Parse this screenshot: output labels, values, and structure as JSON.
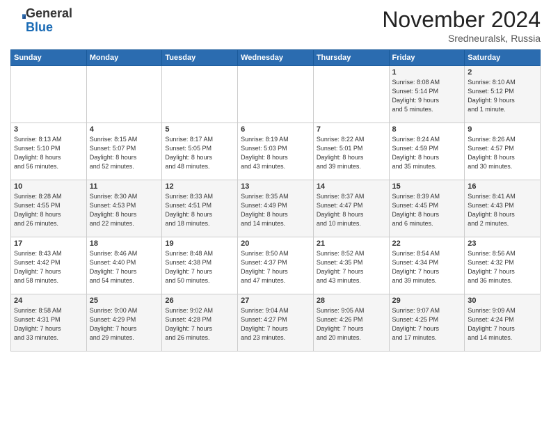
{
  "header": {
    "logo_line1": "General",
    "logo_line2": "Blue",
    "month_title": "November 2024",
    "location": "Sredneuralsk, Russia"
  },
  "days_of_week": [
    "Sunday",
    "Monday",
    "Tuesday",
    "Wednesday",
    "Thursday",
    "Friday",
    "Saturday"
  ],
  "weeks": [
    [
      {
        "day": "",
        "info": ""
      },
      {
        "day": "",
        "info": ""
      },
      {
        "day": "",
        "info": ""
      },
      {
        "day": "",
        "info": ""
      },
      {
        "day": "",
        "info": ""
      },
      {
        "day": "1",
        "info": "Sunrise: 8:08 AM\nSunset: 5:14 PM\nDaylight: 9 hours\nand 5 minutes."
      },
      {
        "day": "2",
        "info": "Sunrise: 8:10 AM\nSunset: 5:12 PM\nDaylight: 9 hours\nand 1 minute."
      }
    ],
    [
      {
        "day": "3",
        "info": "Sunrise: 8:13 AM\nSunset: 5:10 PM\nDaylight: 8 hours\nand 56 minutes."
      },
      {
        "day": "4",
        "info": "Sunrise: 8:15 AM\nSunset: 5:07 PM\nDaylight: 8 hours\nand 52 minutes."
      },
      {
        "day": "5",
        "info": "Sunrise: 8:17 AM\nSunset: 5:05 PM\nDaylight: 8 hours\nand 48 minutes."
      },
      {
        "day": "6",
        "info": "Sunrise: 8:19 AM\nSunset: 5:03 PM\nDaylight: 8 hours\nand 43 minutes."
      },
      {
        "day": "7",
        "info": "Sunrise: 8:22 AM\nSunset: 5:01 PM\nDaylight: 8 hours\nand 39 minutes."
      },
      {
        "day": "8",
        "info": "Sunrise: 8:24 AM\nSunset: 4:59 PM\nDaylight: 8 hours\nand 35 minutes."
      },
      {
        "day": "9",
        "info": "Sunrise: 8:26 AM\nSunset: 4:57 PM\nDaylight: 8 hours\nand 30 minutes."
      }
    ],
    [
      {
        "day": "10",
        "info": "Sunrise: 8:28 AM\nSunset: 4:55 PM\nDaylight: 8 hours\nand 26 minutes."
      },
      {
        "day": "11",
        "info": "Sunrise: 8:30 AM\nSunset: 4:53 PM\nDaylight: 8 hours\nand 22 minutes."
      },
      {
        "day": "12",
        "info": "Sunrise: 8:33 AM\nSunset: 4:51 PM\nDaylight: 8 hours\nand 18 minutes."
      },
      {
        "day": "13",
        "info": "Sunrise: 8:35 AM\nSunset: 4:49 PM\nDaylight: 8 hours\nand 14 minutes."
      },
      {
        "day": "14",
        "info": "Sunrise: 8:37 AM\nSunset: 4:47 PM\nDaylight: 8 hours\nand 10 minutes."
      },
      {
        "day": "15",
        "info": "Sunrise: 8:39 AM\nSunset: 4:45 PM\nDaylight: 8 hours\nand 6 minutes."
      },
      {
        "day": "16",
        "info": "Sunrise: 8:41 AM\nSunset: 4:43 PM\nDaylight: 8 hours\nand 2 minutes."
      }
    ],
    [
      {
        "day": "17",
        "info": "Sunrise: 8:43 AM\nSunset: 4:42 PM\nDaylight: 7 hours\nand 58 minutes."
      },
      {
        "day": "18",
        "info": "Sunrise: 8:46 AM\nSunset: 4:40 PM\nDaylight: 7 hours\nand 54 minutes."
      },
      {
        "day": "19",
        "info": "Sunrise: 8:48 AM\nSunset: 4:38 PM\nDaylight: 7 hours\nand 50 minutes."
      },
      {
        "day": "20",
        "info": "Sunrise: 8:50 AM\nSunset: 4:37 PM\nDaylight: 7 hours\nand 47 minutes."
      },
      {
        "day": "21",
        "info": "Sunrise: 8:52 AM\nSunset: 4:35 PM\nDaylight: 7 hours\nand 43 minutes."
      },
      {
        "day": "22",
        "info": "Sunrise: 8:54 AM\nSunset: 4:34 PM\nDaylight: 7 hours\nand 39 minutes."
      },
      {
        "day": "23",
        "info": "Sunrise: 8:56 AM\nSunset: 4:32 PM\nDaylight: 7 hours\nand 36 minutes."
      }
    ],
    [
      {
        "day": "24",
        "info": "Sunrise: 8:58 AM\nSunset: 4:31 PM\nDaylight: 7 hours\nand 33 minutes."
      },
      {
        "day": "25",
        "info": "Sunrise: 9:00 AM\nSunset: 4:29 PM\nDaylight: 7 hours\nand 29 minutes."
      },
      {
        "day": "26",
        "info": "Sunrise: 9:02 AM\nSunset: 4:28 PM\nDaylight: 7 hours\nand 26 minutes."
      },
      {
        "day": "27",
        "info": "Sunrise: 9:04 AM\nSunset: 4:27 PM\nDaylight: 7 hours\nand 23 minutes."
      },
      {
        "day": "28",
        "info": "Sunrise: 9:05 AM\nSunset: 4:26 PM\nDaylight: 7 hours\nand 20 minutes."
      },
      {
        "day": "29",
        "info": "Sunrise: 9:07 AM\nSunset: 4:25 PM\nDaylight: 7 hours\nand 17 minutes."
      },
      {
        "day": "30",
        "info": "Sunrise: 9:09 AM\nSunset: 4:24 PM\nDaylight: 7 hours\nand 14 minutes."
      }
    ]
  ]
}
